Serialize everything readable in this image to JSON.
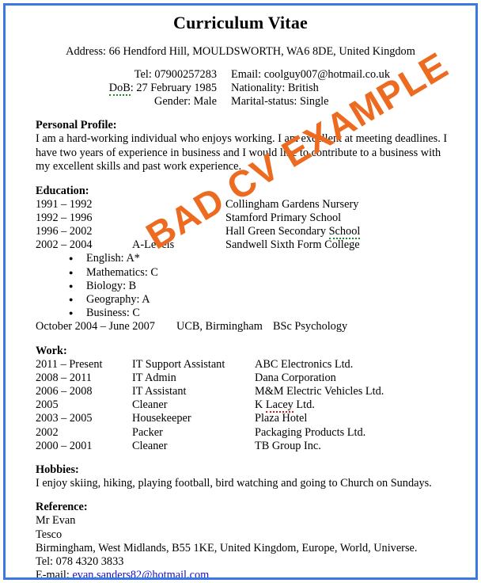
{
  "document": {
    "title": "Curriculum Vitae",
    "address_line": "Address: 66 Hendford Hill, MOULDSWORTH, WA6 8DE, United Kingdom",
    "watermark": "BAD CV EXAMPLE",
    "watermark_color": "#ed6b20",
    "border_color": "#3b78e7",
    "link_color": "#1111cc"
  },
  "contact": {
    "left": [
      "Tel: 07900257283",
      "DoB",
      "Gender: Male"
    ],
    "dob_label": "DoB",
    "dob_value": ": 27 February 1985",
    "right": [
      "Email: coolguy007@hotmail.co.uk",
      "Nationality: British",
      "Marital-status: Single"
    ]
  },
  "personal_profile": {
    "heading": "Personal Profile:",
    "text": "I am a hard-working individual who enjoys working. I am excellent at meeting deadlines. I have two years of experience in business and I would like to contribute to a business with my excellent skills and past work experience."
  },
  "education": {
    "heading": "Education:",
    "rows": [
      {
        "years": "1991 – 1992",
        "qualification": "",
        "institution": "Collingham Gardens Nursery"
      },
      {
        "years": "1992 – 1996",
        "qualification": "",
        "institution": "Stamford Primary School"
      },
      {
        "years": "1996 – 2002",
        "qualification": "",
        "institution": "Hall Green Secondary ",
        "institution_flagged": "School"
      },
      {
        "years": "2002 – 2004",
        "qualification": "A-Levels",
        "institution": "Sandwell Sixth Form College"
      }
    ],
    "grades": [
      "English: A*",
      "Mathematics: C",
      "Biology: B",
      "Geography: A",
      "Business: C"
    ],
    "university": {
      "years": "October 2004 – June 2007",
      "place": "UCB, Birmingham",
      "degree": "BSc Psychology"
    }
  },
  "work": {
    "heading": "Work:",
    "rows": [
      {
        "years": "2011 – Present",
        "role": "IT Support Assistant",
        "company": "ABC Electronics Ltd."
      },
      {
        "years": "2008 – 2011",
        "role": "IT Admin",
        "company": "Dana Corporation"
      },
      {
        "years": "2006 – 2008",
        "role": "IT Assistant",
        "company": "M&M Electric Vehicles Ltd."
      },
      {
        "years": "2005",
        "role": "Cleaner",
        "company_prefix": "K ",
        "company_flagged": "Lacey",
        "company_suffix": " Ltd."
      },
      {
        "years": "2003 – 2005",
        "role": "Housekeeper",
        "company": "Plaza Hotel"
      },
      {
        "years": "2002",
        "role": "Packer",
        "company": "Packaging Products Ltd."
      },
      {
        "years": "2000 – 2001",
        "role": "Cleaner",
        "company": "TB Group Inc."
      }
    ]
  },
  "hobbies": {
    "heading": "Hobbies:",
    "text": "I enjoy skiing, hiking, playing football, bird watching and going to Church on Sundays."
  },
  "reference": {
    "heading": "Reference:",
    "name": "Mr Evan",
    "company": "Tesco",
    "address": "Birmingham, West Midlands, B55 1KE, United Kingdom, Europe, World, Universe.",
    "tel": "Tel: 078 4320 3833",
    "email_label": "E-mail: ",
    "email": "evan.sanders82@hotmail.com"
  }
}
